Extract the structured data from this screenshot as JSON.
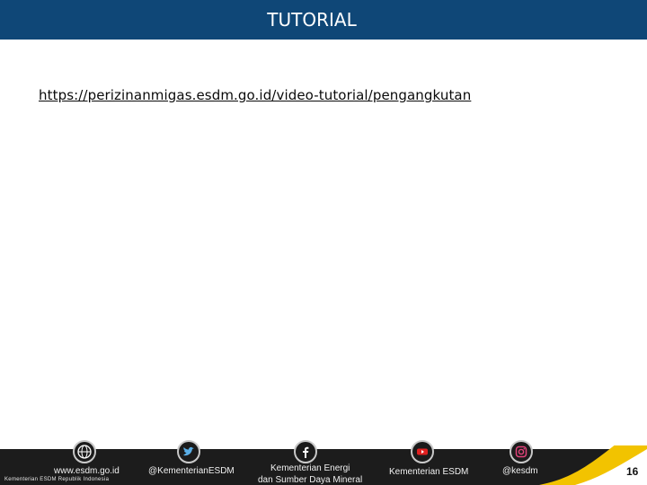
{
  "header": {
    "title": "TUTORIAL"
  },
  "content": {
    "link": "https://perizinanmigas.esdm.go.id/video-tutorial/pengangkutan"
  },
  "footer": {
    "website": "www.esdm.go.id",
    "twitter": "@KementerianESDM",
    "facebook_line1": "Kementerian Energi",
    "facebook_line2": "dan Sumber Daya Mineral",
    "youtube": "Kementerian ESDM",
    "instagram": "@kesdm",
    "agency": "Kementerian ESDM Republik Indonesia",
    "page_number": "16"
  },
  "colors": {
    "header": "#0f4777",
    "footer": "#1c1c1c",
    "accent": "#f2c300"
  },
  "icons": [
    "globe-icon",
    "twitter-icon",
    "facebook-icon",
    "youtube-icon",
    "instagram-icon"
  ]
}
